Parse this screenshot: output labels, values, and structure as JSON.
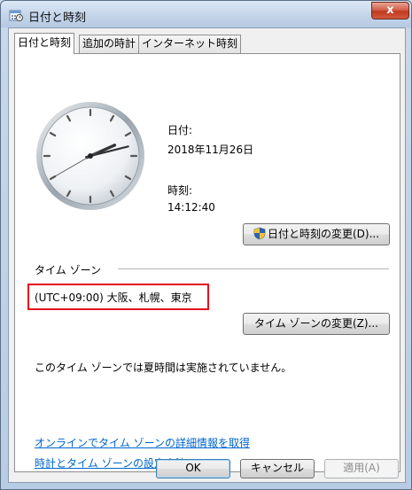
{
  "window": {
    "title": "日付と時刻",
    "close_glyph": "x"
  },
  "tabs": [
    {
      "label": "日付と時刻",
      "active": true
    },
    {
      "label": "追加の時計",
      "active": false
    },
    {
      "label": "インターネット時刻",
      "active": false
    }
  ],
  "date": {
    "label": "日付:",
    "value": "2018年11月26日"
  },
  "time": {
    "label": "時刻:",
    "value": "14:12:40"
  },
  "change_datetime_button": "日付と時刻の変更(D)...",
  "timezone": {
    "group_label": "タイム ゾーン",
    "value": "(UTC+09:00) 大阪、札幌、東京",
    "change_button": "タイム ゾーンの変更(Z)...",
    "dst_note": "このタイム ゾーンでは夏時間は実施されていません。"
  },
  "links": [
    "オンラインでタイム ゾーンの詳細情報を取得",
    "時計とタイム ゾーンの設定方法"
  ],
  "footer": {
    "ok": "OK",
    "cancel": "キャンセル",
    "apply": "適用(A)"
  },
  "colors": {
    "highlight_border": "#e3101b",
    "link": "#0066cc"
  },
  "icons": {
    "app": "calendar-clock-icon",
    "shield": "uac-shield-icon",
    "close": "close-icon"
  }
}
